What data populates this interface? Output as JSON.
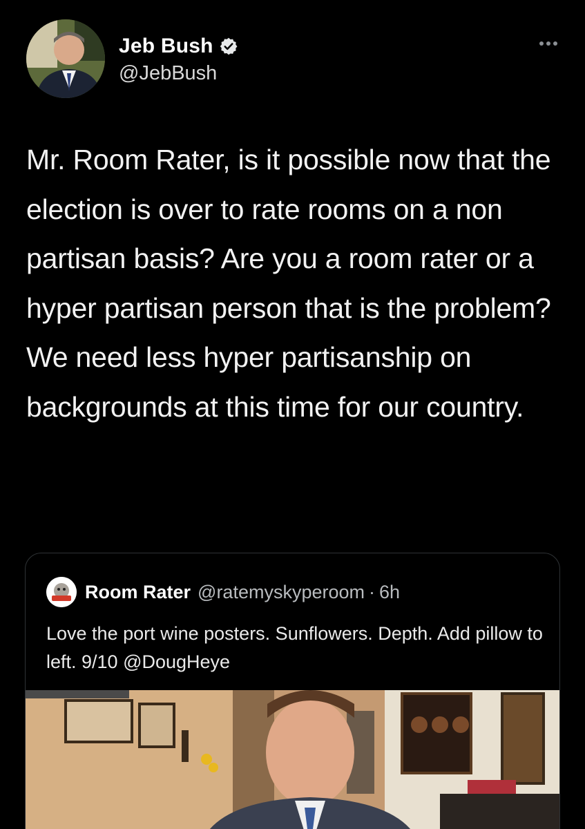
{
  "author": {
    "display_name": "Jeb Bush",
    "handle": "@JebBush",
    "verified": true,
    "avatar_icon": "profile-photo"
  },
  "tweet": {
    "text": "Mr. Room Rater, is it possible now that the election is over to rate rooms on a non partisan basis? Are you a room rater or a hyper partisan person that is the problem? We need less hyper partisanship on backgrounds at this time for our country."
  },
  "quoted_tweet": {
    "display_name": "Room Rater",
    "handle": "@ratemyskyperoom",
    "separator": "·",
    "time": "6h",
    "text": "Love the port wine posters. Sunflowers. Depth. Add pillow to left. 9/10 @DougHeye",
    "media_icon": "video-still-man-in-room"
  },
  "colors": {
    "background": "#000000",
    "primary_text": "#e7e9ea",
    "secondary_text": "#b9bcbf",
    "border": "#2f3336"
  }
}
